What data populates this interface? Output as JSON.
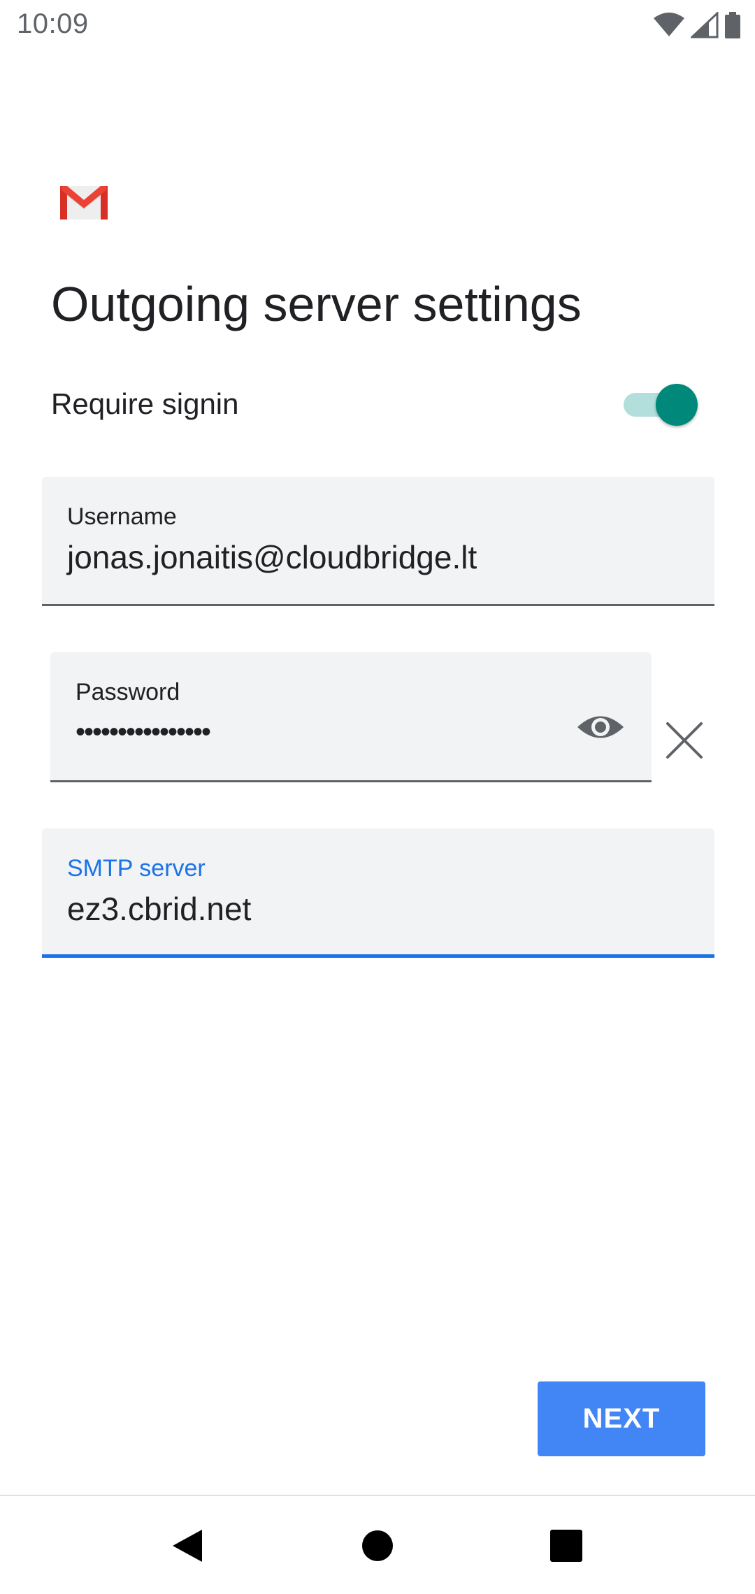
{
  "status_bar": {
    "time": "10:09",
    "icons": [
      "wifi-icon",
      "cell-signal-icon",
      "battery-icon"
    ]
  },
  "header": {
    "logo": "gmail-logo",
    "title": "Outgoing server settings"
  },
  "require_signin": {
    "label": "Require signin",
    "enabled": true
  },
  "fields": {
    "username": {
      "label": "Username",
      "value": "jonas.jonaitis@cloudbridge.lt"
    },
    "password": {
      "label": "Password",
      "value": "••••••••••••••••"
    },
    "smtp": {
      "label": "SMTP server",
      "value": "ez3.cbrid.net"
    }
  },
  "actions": {
    "next_label": "NEXT"
  },
  "navigation": {
    "buttons": [
      "back-icon",
      "home-icon",
      "recents-icon"
    ]
  },
  "colors": {
    "accent": "#1a73e8",
    "button": "#4285f4",
    "toggle_thumb": "#00897b",
    "toggle_track": "#b2dfdb",
    "field_bg": "#f1f3f4"
  }
}
